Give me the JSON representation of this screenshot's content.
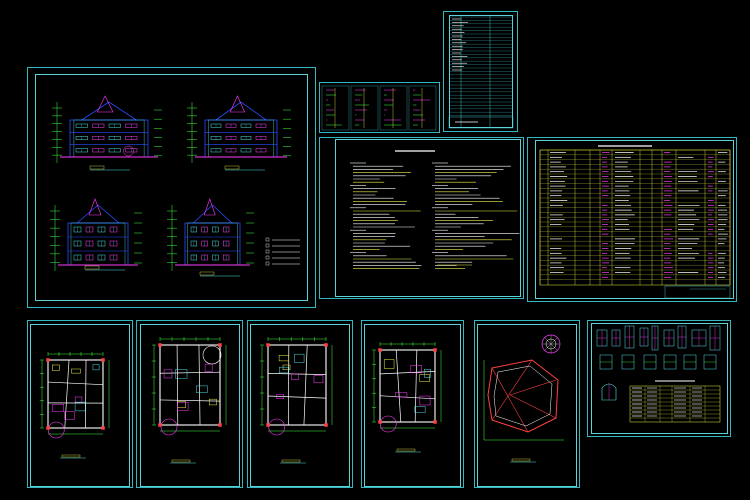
{
  "window": {
    "background": "#000000"
  },
  "colors": {
    "frame": "#34b8c0",
    "line_blue": "#2a4bff",
    "line_cyan": "#4fe0e8",
    "line_magenta": "#ff3cff",
    "line_yellow": "#f2f24a",
    "line_green": "#40ff40",
    "line_red": "#ff4040",
    "text_white": "#ffffff"
  },
  "sheets": {
    "elevations": {
      "title_block": "",
      "notes": [
        "",
        "",
        "",
        "",
        ""
      ]
    },
    "details_strip": {},
    "cover_table": {
      "label": ""
    },
    "design_notes": {
      "heading": "",
      "lines": []
    },
    "schedule": {
      "heading": ""
    },
    "plans": [
      {
        "label": ""
      },
      {
        "label": ""
      },
      {
        "label": ""
      },
      {
        "label": ""
      },
      {
        "label": ""
      }
    ],
    "door_window": {
      "table_heading": ""
    }
  }
}
